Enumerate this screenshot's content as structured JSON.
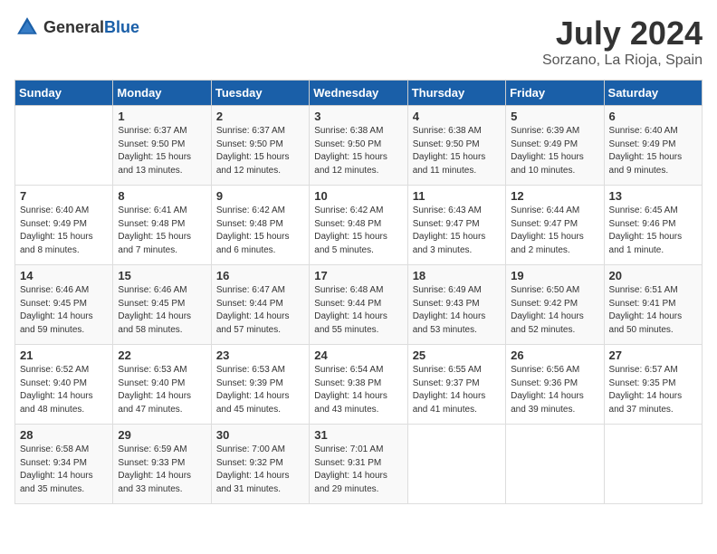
{
  "header": {
    "logo_general": "General",
    "logo_blue": "Blue",
    "month_year": "July 2024",
    "location": "Sorzano, La Rioja, Spain"
  },
  "days_of_week": [
    "Sunday",
    "Monday",
    "Tuesday",
    "Wednesday",
    "Thursday",
    "Friday",
    "Saturday"
  ],
  "weeks": [
    [
      {
        "day": "",
        "sunrise": "",
        "sunset": "",
        "daylight": ""
      },
      {
        "day": "1",
        "sunrise": "Sunrise: 6:37 AM",
        "sunset": "Sunset: 9:50 PM",
        "daylight": "Daylight: 15 hours and 13 minutes."
      },
      {
        "day": "2",
        "sunrise": "Sunrise: 6:37 AM",
        "sunset": "Sunset: 9:50 PM",
        "daylight": "Daylight: 15 hours and 12 minutes."
      },
      {
        "day": "3",
        "sunrise": "Sunrise: 6:38 AM",
        "sunset": "Sunset: 9:50 PM",
        "daylight": "Daylight: 15 hours and 12 minutes."
      },
      {
        "day": "4",
        "sunrise": "Sunrise: 6:38 AM",
        "sunset": "Sunset: 9:50 PM",
        "daylight": "Daylight: 15 hours and 11 minutes."
      },
      {
        "day": "5",
        "sunrise": "Sunrise: 6:39 AM",
        "sunset": "Sunset: 9:49 PM",
        "daylight": "Daylight: 15 hours and 10 minutes."
      },
      {
        "day": "6",
        "sunrise": "Sunrise: 6:40 AM",
        "sunset": "Sunset: 9:49 PM",
        "daylight": "Daylight: 15 hours and 9 minutes."
      }
    ],
    [
      {
        "day": "7",
        "sunrise": "Sunrise: 6:40 AM",
        "sunset": "Sunset: 9:49 PM",
        "daylight": "Daylight: 15 hours and 8 minutes."
      },
      {
        "day": "8",
        "sunrise": "Sunrise: 6:41 AM",
        "sunset": "Sunset: 9:48 PM",
        "daylight": "Daylight: 15 hours and 7 minutes."
      },
      {
        "day": "9",
        "sunrise": "Sunrise: 6:42 AM",
        "sunset": "Sunset: 9:48 PM",
        "daylight": "Daylight: 15 hours and 6 minutes."
      },
      {
        "day": "10",
        "sunrise": "Sunrise: 6:42 AM",
        "sunset": "Sunset: 9:48 PM",
        "daylight": "Daylight: 15 hours and 5 minutes."
      },
      {
        "day": "11",
        "sunrise": "Sunrise: 6:43 AM",
        "sunset": "Sunset: 9:47 PM",
        "daylight": "Daylight: 15 hours and 3 minutes."
      },
      {
        "day": "12",
        "sunrise": "Sunrise: 6:44 AM",
        "sunset": "Sunset: 9:47 PM",
        "daylight": "Daylight: 15 hours and 2 minutes."
      },
      {
        "day": "13",
        "sunrise": "Sunrise: 6:45 AM",
        "sunset": "Sunset: 9:46 PM",
        "daylight": "Daylight: 15 hours and 1 minute."
      }
    ],
    [
      {
        "day": "14",
        "sunrise": "Sunrise: 6:46 AM",
        "sunset": "Sunset: 9:45 PM",
        "daylight": "Daylight: 14 hours and 59 minutes."
      },
      {
        "day": "15",
        "sunrise": "Sunrise: 6:46 AM",
        "sunset": "Sunset: 9:45 PM",
        "daylight": "Daylight: 14 hours and 58 minutes."
      },
      {
        "day": "16",
        "sunrise": "Sunrise: 6:47 AM",
        "sunset": "Sunset: 9:44 PM",
        "daylight": "Daylight: 14 hours and 57 minutes."
      },
      {
        "day": "17",
        "sunrise": "Sunrise: 6:48 AM",
        "sunset": "Sunset: 9:44 PM",
        "daylight": "Daylight: 14 hours and 55 minutes."
      },
      {
        "day": "18",
        "sunrise": "Sunrise: 6:49 AM",
        "sunset": "Sunset: 9:43 PM",
        "daylight": "Daylight: 14 hours and 53 minutes."
      },
      {
        "day": "19",
        "sunrise": "Sunrise: 6:50 AM",
        "sunset": "Sunset: 9:42 PM",
        "daylight": "Daylight: 14 hours and 52 minutes."
      },
      {
        "day": "20",
        "sunrise": "Sunrise: 6:51 AM",
        "sunset": "Sunset: 9:41 PM",
        "daylight": "Daylight: 14 hours and 50 minutes."
      }
    ],
    [
      {
        "day": "21",
        "sunrise": "Sunrise: 6:52 AM",
        "sunset": "Sunset: 9:40 PM",
        "daylight": "Daylight: 14 hours and 48 minutes."
      },
      {
        "day": "22",
        "sunrise": "Sunrise: 6:53 AM",
        "sunset": "Sunset: 9:40 PM",
        "daylight": "Daylight: 14 hours and 47 minutes."
      },
      {
        "day": "23",
        "sunrise": "Sunrise: 6:53 AM",
        "sunset": "Sunset: 9:39 PM",
        "daylight": "Daylight: 14 hours and 45 minutes."
      },
      {
        "day": "24",
        "sunrise": "Sunrise: 6:54 AM",
        "sunset": "Sunset: 9:38 PM",
        "daylight": "Daylight: 14 hours and 43 minutes."
      },
      {
        "day": "25",
        "sunrise": "Sunrise: 6:55 AM",
        "sunset": "Sunset: 9:37 PM",
        "daylight": "Daylight: 14 hours and 41 minutes."
      },
      {
        "day": "26",
        "sunrise": "Sunrise: 6:56 AM",
        "sunset": "Sunset: 9:36 PM",
        "daylight": "Daylight: 14 hours and 39 minutes."
      },
      {
        "day": "27",
        "sunrise": "Sunrise: 6:57 AM",
        "sunset": "Sunset: 9:35 PM",
        "daylight": "Daylight: 14 hours and 37 minutes."
      }
    ],
    [
      {
        "day": "28",
        "sunrise": "Sunrise: 6:58 AM",
        "sunset": "Sunset: 9:34 PM",
        "daylight": "Daylight: 14 hours and 35 minutes."
      },
      {
        "day": "29",
        "sunrise": "Sunrise: 6:59 AM",
        "sunset": "Sunset: 9:33 PM",
        "daylight": "Daylight: 14 hours and 33 minutes."
      },
      {
        "day": "30",
        "sunrise": "Sunrise: 7:00 AM",
        "sunset": "Sunset: 9:32 PM",
        "daylight": "Daylight: 14 hours and 31 minutes."
      },
      {
        "day": "31",
        "sunrise": "Sunrise: 7:01 AM",
        "sunset": "Sunset: 9:31 PM",
        "daylight": "Daylight: 14 hours and 29 minutes."
      },
      {
        "day": "",
        "sunrise": "",
        "sunset": "",
        "daylight": ""
      },
      {
        "day": "",
        "sunrise": "",
        "sunset": "",
        "daylight": ""
      },
      {
        "day": "",
        "sunrise": "",
        "sunset": "",
        "daylight": ""
      }
    ]
  ]
}
